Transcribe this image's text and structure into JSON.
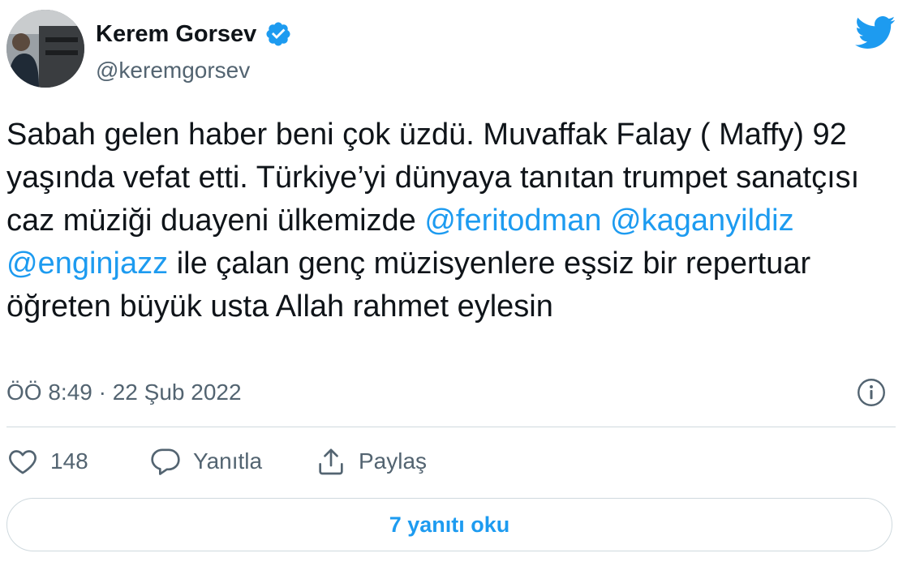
{
  "author": {
    "display_name": "Kerem Gorsev",
    "handle": "@keremgorsev",
    "verified": true
  },
  "tweet": {
    "segments": [
      {
        "type": "text",
        "text": "Sabah gelen haber beni çok üzdü. Muvaffak Falay ( Maffy) 92 yaşında vefat etti. Türkiye’yi dünyaya tanıtan trumpet sanatçısı caz müziği duayeni ülkemizde "
      },
      {
        "type": "mention",
        "text": "@feritodman"
      },
      {
        "type": "text",
        "text": " "
      },
      {
        "type": "mention",
        "text": "@kaganyildiz"
      },
      {
        "type": "text",
        "text": " "
      },
      {
        "type": "mention",
        "text": "@enginjazz"
      },
      {
        "type": "text",
        "text": " ile çalan genç müzisyenlere eşsiz bir repertuar öğreten büyük usta Allah rahmet eylesin"
      }
    ],
    "time": "ÖÖ 8:49",
    "separator": "·",
    "date": "22 Şub 2022"
  },
  "actions": {
    "like_count": "148",
    "reply_label": "Yanıtla",
    "share_label": "Paylaş"
  },
  "read_replies_label": "7 yanıtı oku",
  "icons": {
    "brand": "twitter-bird-icon",
    "verified": "verified-badge-icon",
    "info": "info-icon",
    "like": "heart-icon",
    "reply": "speech-bubble-icon",
    "share": "share-icon"
  },
  "colors": {
    "accent": "#1d9bf0",
    "text_primary": "#0f1419",
    "text_secondary": "#536471",
    "border": "#cfd9de"
  }
}
